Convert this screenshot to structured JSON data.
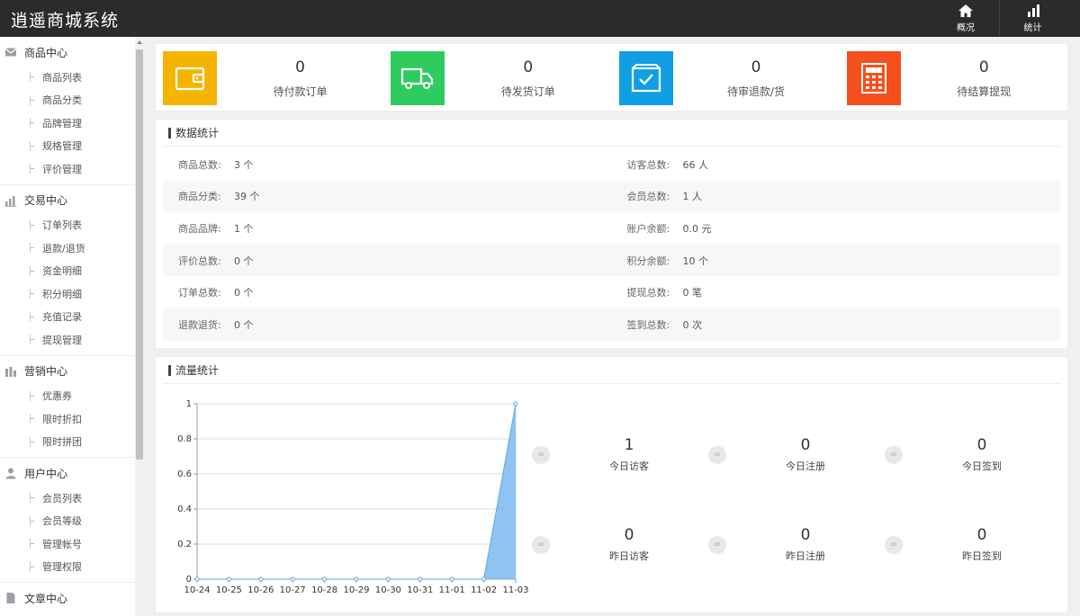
{
  "app": {
    "title": "逍遥商城系统"
  },
  "top_nav": [
    {
      "label": "概况",
      "icon": "home-icon"
    },
    {
      "label": "统计",
      "icon": "bar-chart-icon"
    }
  ],
  "sidebar": {
    "groups": [
      {
        "label": "商品中心",
        "icon": "mail-icon",
        "items": [
          "商品列表",
          "商品分类",
          "品牌管理",
          "规格管理",
          "评价管理"
        ]
      },
      {
        "label": "交易中心",
        "icon": "bar-chart-icon",
        "items": [
          "订单列表",
          "退款/退货",
          "资金明细",
          "积分明细",
          "充值记录",
          "提现管理"
        ]
      },
      {
        "label": "营销中心",
        "icon": "grid-chart-icon",
        "items": [
          "优惠券",
          "限时折扣",
          "限时拼团"
        ]
      },
      {
        "label": "用户中心",
        "icon": "user-icon",
        "items": [
          "会员列表",
          "会员等级",
          "管理帐号",
          "管理权限"
        ]
      },
      {
        "label": "文章中心",
        "icon": "document-icon",
        "items": []
      }
    ]
  },
  "stat_cards": [
    {
      "value": "0",
      "label": "待付款订单",
      "color": "#f5b400",
      "icon": "wallet-icon"
    },
    {
      "value": "0",
      "label": "待发货订单",
      "color": "#2ecc5f",
      "icon": "truck-icon"
    },
    {
      "value": "0",
      "label": "待审退款/货",
      "color": "#109fe4",
      "icon": "box-check-icon"
    },
    {
      "value": "0",
      "label": "待结算提现",
      "color": "#f5501e",
      "icon": "calculator-icon"
    }
  ],
  "data_stats": {
    "title": "数据统计",
    "rows": [
      [
        {
          "key": "商品总数:",
          "value": "3 个"
        },
        {
          "key": "访客总数:",
          "value": "66 人"
        }
      ],
      [
        {
          "key": "商品分类:",
          "value": "39 个"
        },
        {
          "key": "会员总数:",
          "value": "1 人"
        }
      ],
      [
        {
          "key": "商品品牌:",
          "value": "1 个"
        },
        {
          "key": "账户余额:",
          "value": "0.0 元"
        }
      ],
      [
        {
          "key": "评价总数:",
          "value": "0 个"
        },
        {
          "key": "积分余额:",
          "value": "10 个"
        }
      ],
      [
        {
          "key": "订单总数:",
          "value": "0 个"
        },
        {
          "key": "提现总数:",
          "value": "0 笔"
        }
      ],
      [
        {
          "key": "退款退货:",
          "value": "0 个"
        },
        {
          "key": "签到总数:",
          "value": "0 次"
        }
      ]
    ]
  },
  "traffic": {
    "title": "流量统计",
    "kpis": [
      {
        "value": "1",
        "label": "今日访客",
        "eq": "="
      },
      {
        "value": "0",
        "label": "今日注册",
        "eq": "="
      },
      {
        "value": "0",
        "label": "今日签到",
        "eq": "="
      },
      {
        "value": "0",
        "label": "昨日访客",
        "eq": "="
      },
      {
        "value": "0",
        "label": "昨日注册",
        "eq": "="
      },
      {
        "value": "0",
        "label": "昨日签到",
        "eq": "="
      }
    ]
  },
  "chart_data": {
    "type": "area",
    "x": [
      "10-24",
      "10-25",
      "10-26",
      "10-27",
      "10-28",
      "10-29",
      "10-30",
      "10-31",
      "11-01",
      "11-02",
      "11-03"
    ],
    "series": [
      {
        "values": [
          0,
          0,
          0,
          0,
          0,
          0,
          0,
          0,
          0,
          0,
          1
        ],
        "color": "#7db8ee"
      }
    ],
    "ylim": [
      0,
      1
    ],
    "yticks": [
      "0",
      "0.2",
      "0.4",
      "0.6",
      "0.8",
      "1"
    ],
    "grid": true
  }
}
